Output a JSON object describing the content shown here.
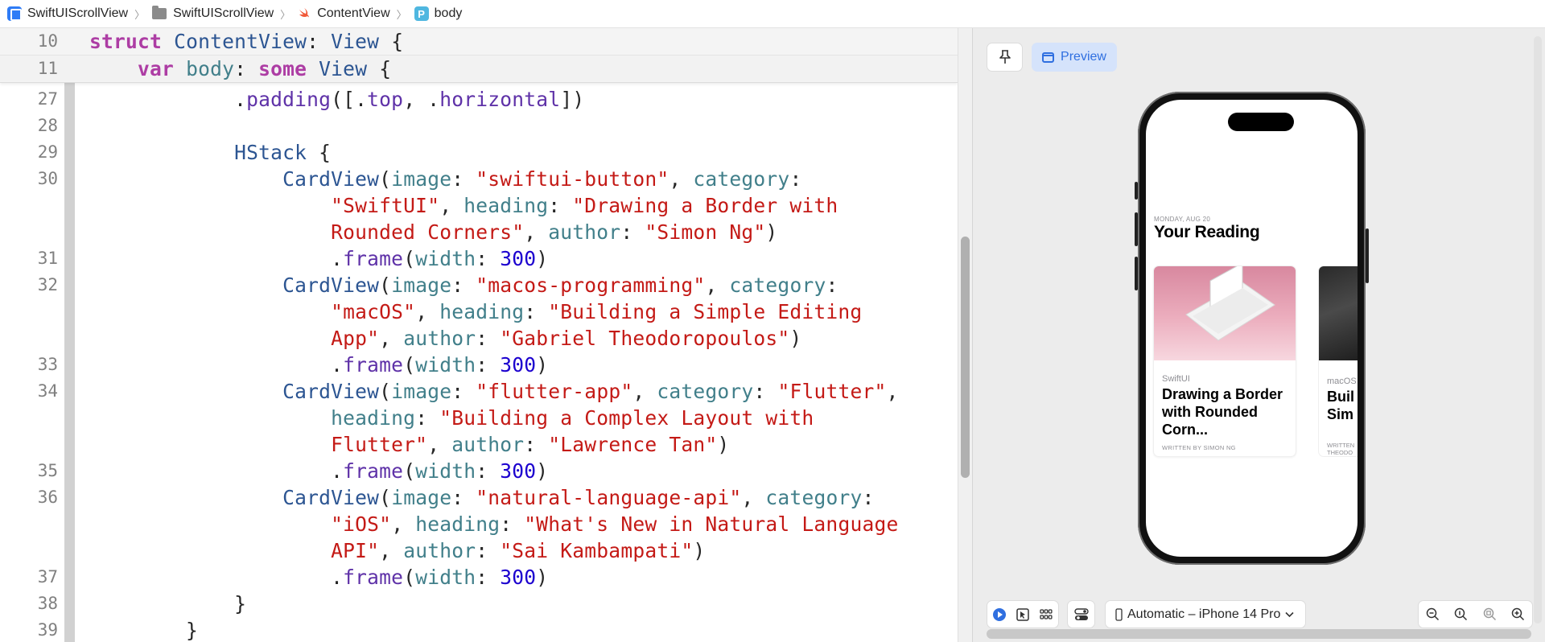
{
  "breadcrumb": {
    "items": [
      {
        "label": "SwiftUIScrollView",
        "icon": "app-icon"
      },
      {
        "label": "SwiftUIScrollView",
        "icon": "folder-icon"
      },
      {
        "label": "ContentView",
        "icon": "swift-file-icon"
      },
      {
        "label": "body",
        "icon": "property-icon",
        "badge": "P"
      }
    ]
  },
  "editor": {
    "sticky_lines": [
      {
        "num": "10",
        "tokens": [
          [
            "k",
            "struct"
          ],
          [
            "",
            " "
          ],
          [
            "t",
            "ContentView"
          ],
          [
            "",
            ": "
          ],
          [
            "t",
            "View"
          ],
          [
            "",
            " {"
          ]
        ]
      },
      {
        "num": "11",
        "tokens": [
          [
            "",
            "    "
          ],
          [
            "k",
            "var"
          ],
          [
            "",
            " "
          ],
          [
            "p",
            "body"
          ],
          [
            "",
            ": "
          ],
          [
            "k",
            "some"
          ],
          [
            "",
            " "
          ],
          [
            "t",
            "View"
          ],
          [
            "",
            " {"
          ]
        ]
      }
    ],
    "lines": [
      {
        "num": "27",
        "tokens": [
          [
            "",
            "            ."
          ],
          [
            "f",
            "padding"
          ],
          [
            "",
            "([."
          ],
          [
            "f",
            "top"
          ],
          [
            "",
            ", ."
          ],
          [
            "f",
            "horizontal"
          ],
          [
            "",
            "])"
          ]
        ]
      },
      {
        "num": "28",
        "tokens": []
      },
      {
        "num": "29",
        "tokens": [
          [
            "",
            "            "
          ],
          [
            "t",
            "HStack"
          ],
          [
            "",
            " {"
          ]
        ]
      },
      {
        "num": "30",
        "tokens": [
          [
            "",
            "                "
          ],
          [
            "t",
            "CardView"
          ],
          [
            "",
            "("
          ],
          [
            "p",
            "image"
          ],
          [
            "",
            ": "
          ],
          [
            "s",
            "\"swiftui-button\""
          ],
          [
            "",
            ", "
          ],
          [
            "p",
            "category"
          ],
          [
            "",
            ":"
          ]
        ]
      },
      {
        "num": "",
        "tokens": [
          [
            "",
            "                    "
          ],
          [
            "s",
            "\"SwiftUI\""
          ],
          [
            "",
            ", "
          ],
          [
            "p",
            "heading"
          ],
          [
            "",
            ": "
          ],
          [
            "s",
            "\"Drawing a Border with"
          ]
        ]
      },
      {
        "num": "",
        "tokens": [
          [
            "",
            "                    "
          ],
          [
            "s",
            "Rounded Corners\""
          ],
          [
            "",
            ", "
          ],
          [
            "p",
            "author"
          ],
          [
            "",
            ": "
          ],
          [
            "s",
            "\"Simon Ng\""
          ],
          [
            "",
            ")"
          ]
        ]
      },
      {
        "num": "31",
        "tokens": [
          [
            "",
            "                    ."
          ],
          [
            "f",
            "frame"
          ],
          [
            "",
            "("
          ],
          [
            "p",
            "width"
          ],
          [
            "",
            ": "
          ],
          [
            "n",
            "300"
          ],
          [
            "",
            ")"
          ]
        ]
      },
      {
        "num": "32",
        "tokens": [
          [
            "",
            "                "
          ],
          [
            "t",
            "CardView"
          ],
          [
            "",
            "("
          ],
          [
            "p",
            "image"
          ],
          [
            "",
            ": "
          ],
          [
            "s",
            "\"macos-programming\""
          ],
          [
            "",
            ", "
          ],
          [
            "p",
            "category"
          ],
          [
            "",
            ":"
          ]
        ]
      },
      {
        "num": "",
        "tokens": [
          [
            "",
            "                    "
          ],
          [
            "s",
            "\"macOS\""
          ],
          [
            "",
            ", "
          ],
          [
            "p",
            "heading"
          ],
          [
            "",
            ": "
          ],
          [
            "s",
            "\"Building a Simple Editing"
          ]
        ]
      },
      {
        "num": "",
        "tokens": [
          [
            "",
            "                    "
          ],
          [
            "s",
            "App\""
          ],
          [
            "",
            ", "
          ],
          [
            "p",
            "author"
          ],
          [
            "",
            ": "
          ],
          [
            "s",
            "\"Gabriel Theodoropoulos\""
          ],
          [
            "",
            ")"
          ]
        ]
      },
      {
        "num": "33",
        "tokens": [
          [
            "",
            "                    ."
          ],
          [
            "f",
            "frame"
          ],
          [
            "",
            "("
          ],
          [
            "p",
            "width"
          ],
          [
            "",
            ": "
          ],
          [
            "n",
            "300"
          ],
          [
            "",
            ")"
          ]
        ]
      },
      {
        "num": "34",
        "tokens": [
          [
            "",
            "                "
          ],
          [
            "t",
            "CardView"
          ],
          [
            "",
            "("
          ],
          [
            "p",
            "image"
          ],
          [
            "",
            ": "
          ],
          [
            "s",
            "\"flutter-app\""
          ],
          [
            "",
            ", "
          ],
          [
            "p",
            "category"
          ],
          [
            "",
            ": "
          ],
          [
            "s",
            "\"Flutter\""
          ],
          [
            "",
            ","
          ]
        ]
      },
      {
        "num": "",
        "tokens": [
          [
            "",
            "                    "
          ],
          [
            "p",
            "heading"
          ],
          [
            "",
            ": "
          ],
          [
            "s",
            "\"Building a Complex Layout with"
          ]
        ]
      },
      {
        "num": "",
        "tokens": [
          [
            "",
            "                    "
          ],
          [
            "s",
            "Flutter\""
          ],
          [
            "",
            ", "
          ],
          [
            "p",
            "author"
          ],
          [
            "",
            ": "
          ],
          [
            "s",
            "\"Lawrence Tan\""
          ],
          [
            "",
            ")"
          ]
        ]
      },
      {
        "num": "35",
        "tokens": [
          [
            "",
            "                    ."
          ],
          [
            "f",
            "frame"
          ],
          [
            "",
            "("
          ],
          [
            "p",
            "width"
          ],
          [
            "",
            ": "
          ],
          [
            "n",
            "300"
          ],
          [
            "",
            ")"
          ]
        ]
      },
      {
        "num": "36",
        "tokens": [
          [
            "",
            "                "
          ],
          [
            "t",
            "CardView"
          ],
          [
            "",
            "("
          ],
          [
            "p",
            "image"
          ],
          [
            "",
            ": "
          ],
          [
            "s",
            "\"natural-language-api\""
          ],
          [
            "",
            ", "
          ],
          [
            "p",
            "category"
          ],
          [
            "",
            ":"
          ]
        ]
      },
      {
        "num": "",
        "tokens": [
          [
            "",
            "                    "
          ],
          [
            "s",
            "\"iOS\""
          ],
          [
            "",
            ", "
          ],
          [
            "p",
            "heading"
          ],
          [
            "",
            ": "
          ],
          [
            "s",
            "\"What's New in Natural Language"
          ]
        ]
      },
      {
        "num": "",
        "tokens": [
          [
            "",
            "                    "
          ],
          [
            "s",
            "API\""
          ],
          [
            "",
            ", "
          ],
          [
            "p",
            "author"
          ],
          [
            "",
            ": "
          ],
          [
            "s",
            "\"Sai Kambampati\""
          ],
          [
            "",
            ")"
          ]
        ]
      },
      {
        "num": "37",
        "tokens": [
          [
            "",
            "                    ."
          ],
          [
            "f",
            "frame"
          ],
          [
            "",
            "("
          ],
          [
            "p",
            "width"
          ],
          [
            "",
            ": "
          ],
          [
            "n",
            "300"
          ],
          [
            "",
            ")"
          ]
        ]
      },
      {
        "num": "38",
        "tokens": [
          [
            "",
            "            }"
          ]
        ]
      },
      {
        "num": "39",
        "tokens": [
          [
            "",
            "        }"
          ]
        ]
      }
    ]
  },
  "canvas": {
    "preview_label": "Preview",
    "pin_icon": "pin-icon",
    "device_label": "Automatic – iPhone 14 Pro",
    "phone": {
      "date": "MONDAY, AUG 20",
      "heading": "Your Reading",
      "card1": {
        "category": "SwiftUI",
        "heading": "Drawing a Border with Rounded Corn...",
        "author": "WRITTEN BY SIMON NG"
      },
      "card2": {
        "category": "macOS",
        "heading_line1": "Buil",
        "heading_line2": "Sim",
        "author_line1": "WRITTEN",
        "author_line2": "THEODO"
      }
    }
  },
  "colors": {
    "keyword": "#ad3da4",
    "type": "#2c5592",
    "param": "#417f8a",
    "func": "#5f32a8",
    "string": "#c41a16",
    "number": "#1c00cf",
    "accent": "#2f6fe0"
  }
}
